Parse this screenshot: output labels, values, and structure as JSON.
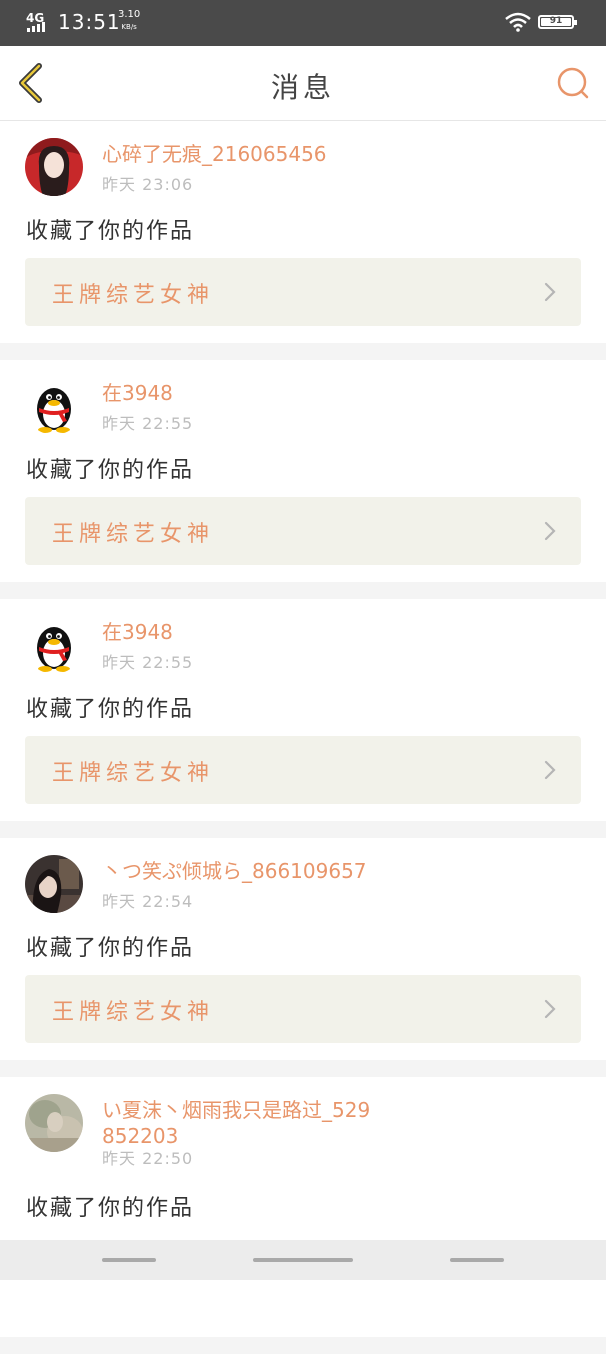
{
  "status_bar": {
    "network": "4G",
    "time": "13:51",
    "speed_value": "3.10",
    "speed_unit": "KB/s",
    "battery_level": "91"
  },
  "header": {
    "title": "消息",
    "back_icon": "chevron-left-icon",
    "search_icon": "search-icon",
    "accent_color": "#e8956a"
  },
  "messages": [
    {
      "user": "心碎了无痕_216065456",
      "time": "昨天  23:06",
      "action": "收藏了你的作品",
      "work_title": "王牌综艺女神",
      "avatar": "photo-girl-red"
    },
    {
      "user": "在3948",
      "time": "昨天  22:55",
      "action": "收藏了你的作品",
      "work_title": "王牌综艺女神",
      "avatar": "qq-penguin"
    },
    {
      "user": "在3948",
      "time": "昨天  22:55",
      "action": "收藏了你的作品",
      "work_title": "王牌综艺女神",
      "avatar": "qq-penguin"
    },
    {
      "user": "丶つ笑ぷ倾城ら_866109657",
      "time": "昨天  22:54",
      "action": "收藏了你的作品",
      "work_title": "王牌综艺女神",
      "avatar": "photo-girl-dark"
    },
    {
      "user": "い夏沫丶烟雨我只是路过_529852203",
      "time": "昨天  22:50",
      "action": "收藏了你的作品",
      "work_title": "王牌综艺女神",
      "avatar": "photo-faded"
    }
  ]
}
